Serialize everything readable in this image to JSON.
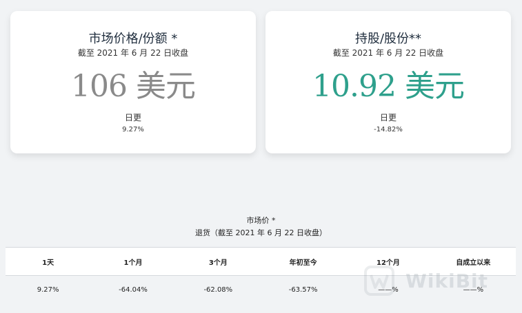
{
  "cards": {
    "market_price": {
      "title": "市场价格/份额 *",
      "subtitle": "截至 2021 年 6 月 22 日收盘",
      "value": "106 美元",
      "change_label": "日更",
      "change_value": "9.27%"
    },
    "holdings": {
      "title": "持股/股份**",
      "subtitle": "截至 2021 年 6 月 22 日收盘",
      "value": "10.92 美元",
      "change_label": "日更",
      "change_value": "-14.82%"
    }
  },
  "performance": {
    "title": "市场价 *",
    "subtitle": "退货（截至 2021 年 6 月 22 日收盘）",
    "headers": [
      "1天",
      "1个月",
      "3个月",
      "年初至今",
      "12个月",
      "自成立以来"
    ],
    "values": [
      "9.27%",
      "-64.04%",
      "-62.08%",
      "-63.57%",
      "——%",
      "——%"
    ]
  },
  "watermark": {
    "text": "WikiBit",
    "icon": "wikibit-logo-icon"
  },
  "colors": {
    "background": "#f1f3f5",
    "market_value": "#8a8a8a",
    "holdings_value": "#2ea08c"
  }
}
